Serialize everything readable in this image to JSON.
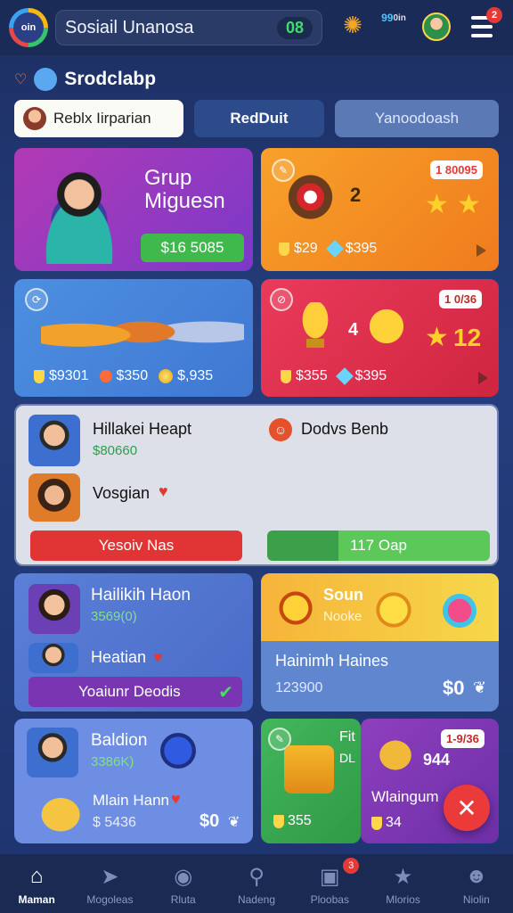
{
  "header": {
    "logo_text": "oin",
    "search_title": "Sosiail Unanosa",
    "search_pill": "08",
    "stat_top": "99",
    "stat_bottom": "0in",
    "notification_count": "2"
  },
  "section": {
    "title": "Srodclabp"
  },
  "tabs": [
    {
      "label": "Reblx Iirparian"
    },
    {
      "label": "RedDuit"
    },
    {
      "label": "Yanoodoash"
    }
  ],
  "cards": {
    "group": {
      "title_line1": "Grup",
      "title_line2": "Miguesn",
      "price": "$16 5085"
    },
    "orange": {
      "badge": "1 80095",
      "rank": "2",
      "stat1": "$29",
      "stat2": "$395"
    },
    "blue": {
      "stat1": "$9301",
      "stat2": "$350",
      "stat3": "$,935"
    },
    "red": {
      "badge": "1 0/36",
      "rank": "4",
      "score": "12",
      "stat1": "$355",
      "stat2": "$395"
    },
    "feed": {
      "user1_name": "Hillakei Heapt",
      "user1_meta": "$80660",
      "user2_name": "Vosgian",
      "right_label": "Dodvs Benb",
      "left_button": "Yesoiv Nas",
      "right_button": "117 Oap"
    },
    "purple_blue": {
      "name": "Hailikih Haon",
      "meta": "3569(0)",
      "sub": "Heatian",
      "button": "Yoaiunr Deodis"
    },
    "gold": {
      "title": "Soun",
      "subtitle": "Nooke",
      "name": "Hainimh Haines",
      "value": "123900",
      "price": "$0"
    },
    "baldian": {
      "name": "Baldion",
      "meta": "3386K)",
      "sub": "Mlain Hann",
      "price": "$ 5436",
      "price2": "$0"
    },
    "green": {
      "title": "Fit",
      "subtitle": "DL",
      "price": "355"
    },
    "violet": {
      "badge": "1-9/36",
      "value": "944",
      "name": "Wlaingum",
      "price": "34"
    }
  },
  "nav": [
    {
      "label": "Maman"
    },
    {
      "label": "Mogoleas"
    },
    {
      "label": "Rluta"
    },
    {
      "label": "Nadeng"
    },
    {
      "label": "Ploobas",
      "badge": "3"
    },
    {
      "label": "Mlorios"
    },
    {
      "label": "Niolin"
    }
  ]
}
